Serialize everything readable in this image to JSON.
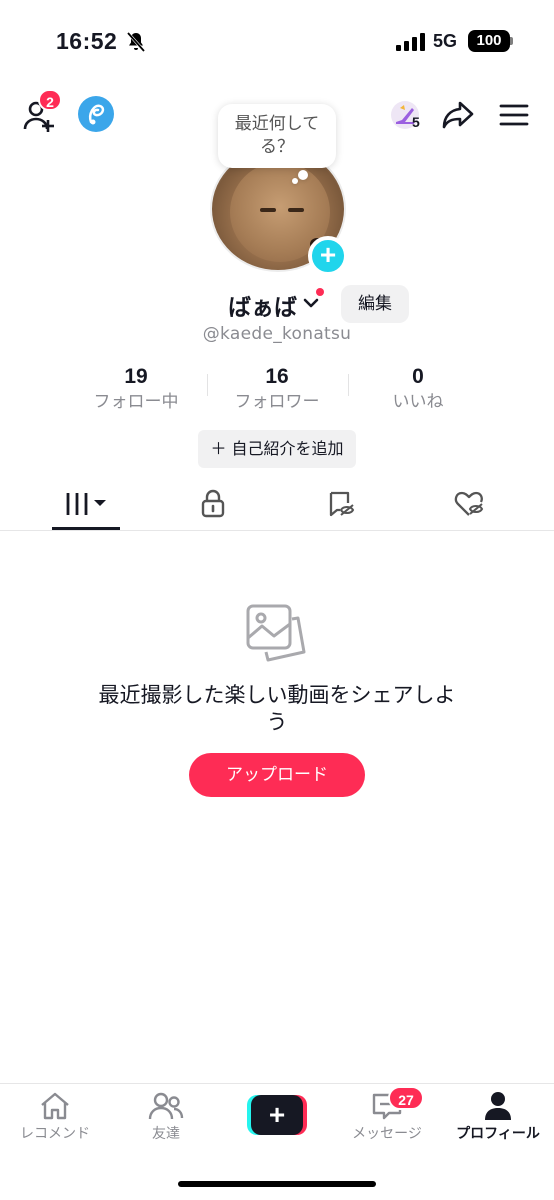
{
  "status_bar": {
    "time": "16:52",
    "network": "5G",
    "battery": "100"
  },
  "header": {
    "friend_requests_badge": "2",
    "level": "5"
  },
  "profile": {
    "status_bubble": "最近何してる？",
    "display_name": "ばぁば",
    "edit_label": "編集",
    "username": "@kaede_konatsu",
    "bio_button": "＋ 自己紹介を追加"
  },
  "stats": [
    {
      "value": "19",
      "label": "フォロー中"
    },
    {
      "value": "16",
      "label": "フォロワー"
    },
    {
      "value": "0",
      "label": "いいね"
    }
  ],
  "tabs": [
    {
      "icon": "grid-icon"
    },
    {
      "icon": "lock-icon"
    },
    {
      "icon": "hidden-repost-icon"
    },
    {
      "icon": "hidden-liked-icon"
    }
  ],
  "empty_state": {
    "message": "最近撮影した楽しい動画をシェアしよう",
    "upload_label": "アップロード"
  },
  "bottom_nav": {
    "items": [
      {
        "label": "レコメンド",
        "icon": "home-icon"
      },
      {
        "label": "友達",
        "icon": "friends-icon"
      },
      {
        "label": "",
        "icon": "create-icon"
      },
      {
        "label": "メッセージ",
        "icon": "inbox-icon"
      },
      {
        "label": "プロフィール",
        "icon": "profile-icon"
      }
    ],
    "messages_badge": "27"
  },
  "colors": {
    "accent": "#fe2c55",
    "cyan": "#20d5ec",
    "text": "#161823",
    "secondary": "#8a8b91"
  }
}
